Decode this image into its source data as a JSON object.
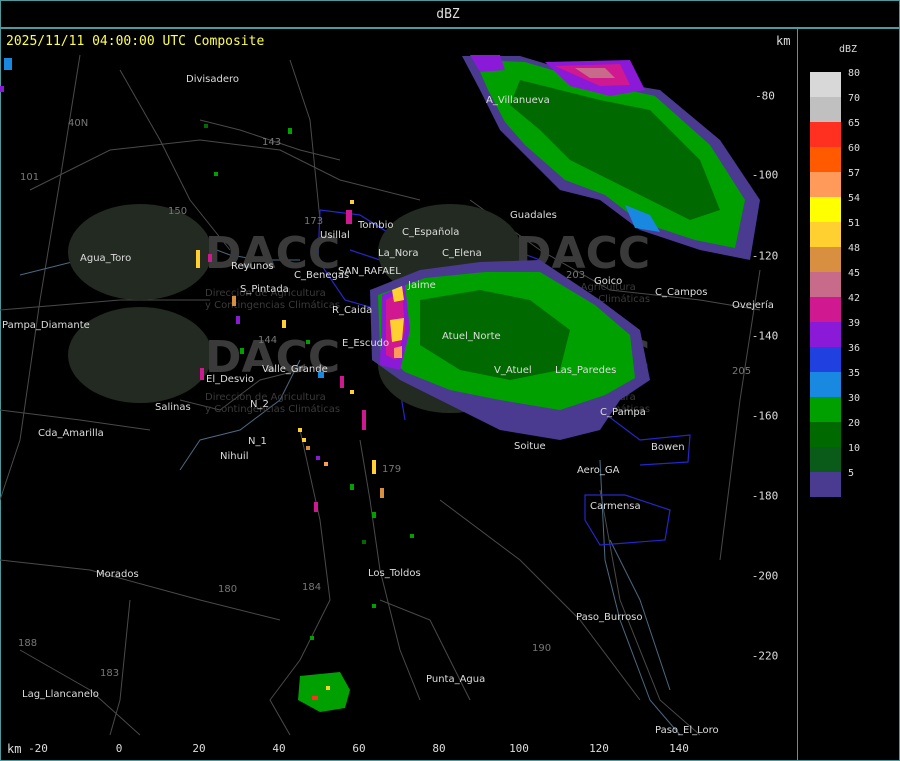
{
  "header": {
    "product": "dBZ"
  },
  "map": {
    "timestamp": "2025/11/11 04:00:00 UTC Composite",
    "km_label_top": "km",
    "km_label_bottom": "km",
    "x_ticks": [
      "-20",
      "0",
      "20",
      "40",
      "60",
      "80",
      "100",
      "120",
      "140"
    ],
    "y_ticks": [
      "-80",
      "-100",
      "-120",
      "-140",
      "-160",
      "-180",
      "-200",
      "-220"
    ],
    "watermark": {
      "logo_text": "DACC",
      "subtitle_lines": [
        "Dirección de Agricultura",
        "y Contingencias Climáticas"
      ]
    },
    "places": [
      "Divisadero",
      "A_Villanueva",
      "Guadales",
      "Usillal",
      "Tombio",
      "C_Española",
      "La_Nora",
      "C_Elena",
      "Agua_Toro",
      "Reyunos",
      "S_Pintada",
      "C_Benegas",
      "SAN_RAFAEL",
      "R_Caida",
      "Jaime",
      "Atuel_Norte",
      "V_Atuel",
      "Goico",
      "C_Campos",
      "Ovejería",
      "Pampa_Diamante",
      "E_Escudo",
      "El_Desvio",
      "Valle_Grande",
      "Salinas",
      "N_2",
      "N_1",
      "Nihuil",
      "Cda_Amarilla",
      "Soitue",
      "Aero_GA",
      "Bowen",
      "Carmensa",
      "Los_Toldos",
      "Morados",
      "Paso_Burroso",
      "Punta_Agua",
      "Lag_Llancanelo",
      "Paso_El_Loro",
      "Las_Paredes",
      "C_Pampa"
    ],
    "routes": [
      "143",
      "101",
      "40N",
      "150",
      "144",
      "173",
      "184",
      "180",
      "179",
      "190",
      "183",
      "188",
      "203",
      "205"
    ]
  },
  "legend": {
    "title": "dBZ",
    "levels": [
      {
        "label": "80",
        "color": "#d8d8d8"
      },
      {
        "label": "70",
        "color": "#c0c0c0"
      },
      {
        "label": "65",
        "color": "#ff3020"
      },
      {
        "label": "60",
        "color": "#ff5a00"
      },
      {
        "label": "57",
        "color": "#ff9a5a"
      },
      {
        "label": "54",
        "color": "#ffff00"
      },
      {
        "label": "51",
        "color": "#ffd030"
      },
      {
        "label": "48",
        "color": "#d89040"
      },
      {
        "label": "45",
        "color": "#c86a8a"
      },
      {
        "label": "42",
        "color": "#d01890"
      },
      {
        "label": "39",
        "color": "#8a1ad8"
      },
      {
        "label": "36",
        "color": "#2040e0"
      },
      {
        "label": "35",
        "color": "#1888e0"
      },
      {
        "label": "30",
        "color": "#00a000"
      },
      {
        "label": "20",
        "color": "#006a00"
      },
      {
        "label": "10",
        "color": "#0a5a1a"
      },
      {
        "label": "5",
        "color": "#4a3a90"
      }
    ]
  }
}
